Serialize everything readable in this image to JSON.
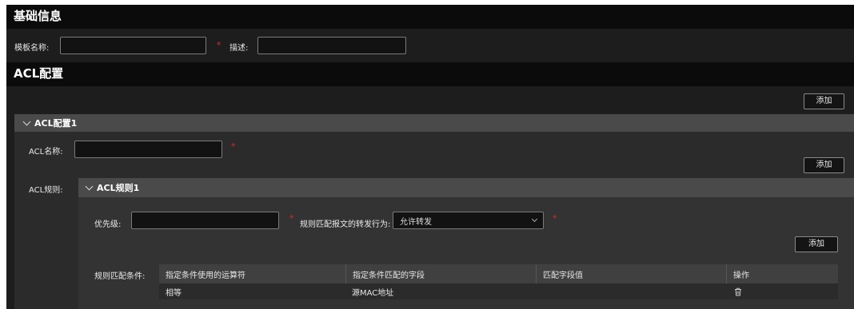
{
  "basic": {
    "title": "基础信息",
    "template_name_label": "模板名称:",
    "template_name_value": "",
    "required_mark": "*",
    "desc_label": "描述:",
    "desc_value": ""
  },
  "acl": {
    "title": "ACL配置",
    "add_label": "添加",
    "config": {
      "header": "ACL配置1",
      "name_label": "ACL名称:",
      "name_value": "",
      "required_mark": "*",
      "rules_label": "ACL规则:",
      "add_label": "添加",
      "rule": {
        "header": "ACL规则1",
        "priority_label": "优先级:",
        "priority_value": "",
        "required_mark": "*",
        "action_label": "规则匹配报文的转发行为:",
        "action_value": "允许转发",
        "action_required_mark": "*",
        "add_label": "添加",
        "conditions_label": "规则匹配条件:",
        "table": {
          "columns": [
            "指定条件使用的运算符",
            "指定条件匹配的字段",
            "匹配字段值",
            "操作"
          ],
          "rows": [
            {
              "operator": "相等",
              "field": "源MAC地址",
              "value": "",
              "action_icon": "trash-icon"
            }
          ]
        }
      }
    }
  },
  "colors": {
    "required": "#e0262d",
    "header_bar": "#0b0b0b",
    "panel": "#1d1d1d",
    "accordion": "#4a4a4a"
  }
}
